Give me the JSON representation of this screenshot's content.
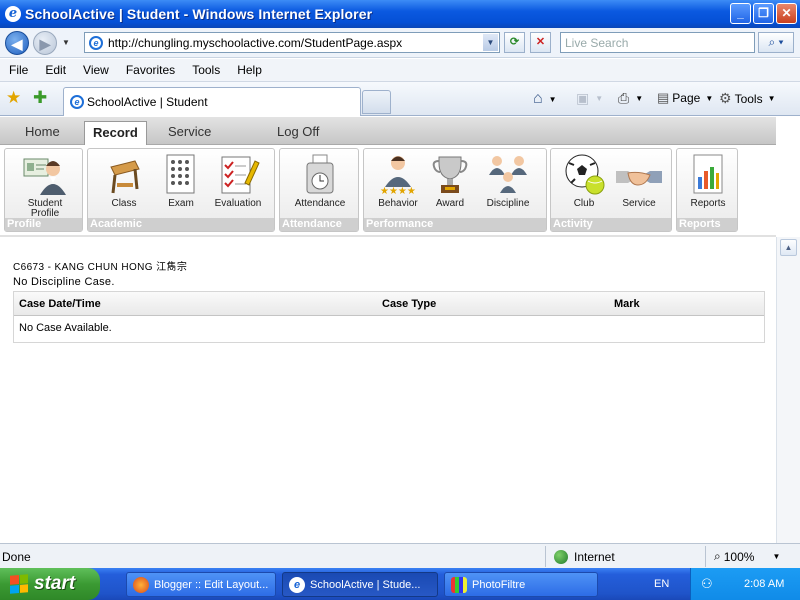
{
  "window": {
    "title": "SchoolActive | Student - Windows Internet Explorer"
  },
  "address": {
    "url": "http://chungling.myschoolactive.com/StudentPage.aspx",
    "search_placeholder": "Live Search"
  },
  "menu": [
    "File",
    "Edit",
    "View",
    "Favorites",
    "Tools",
    "Help"
  ],
  "tab": {
    "title": "SchoolActive | Student"
  },
  "commands": {
    "page": "Page",
    "tools": "Tools"
  },
  "app_nav": [
    "Home",
    "Record",
    "Service",
    "Log Off"
  ],
  "app_nav_active": "Record",
  "groups": [
    {
      "label": "Profile",
      "items": [
        {
          "label": "Student Profile",
          "icon": "student-profile-icon"
        }
      ]
    },
    {
      "label": "Academic",
      "items": [
        {
          "label": "Class",
          "icon": "class-desk-icon"
        },
        {
          "label": "Exam",
          "icon": "exam-sheet-icon"
        },
        {
          "label": "Evaluation",
          "icon": "evaluation-checklist-icon"
        }
      ]
    },
    {
      "label": "Attendance",
      "items": [
        {
          "label": "Attendance",
          "icon": "attendance-clock-icon"
        }
      ]
    },
    {
      "label": "Performance",
      "items": [
        {
          "label": "Behavior",
          "icon": "behavior-stars-icon"
        },
        {
          "label": "Award",
          "icon": "award-trophy-icon"
        },
        {
          "label": "Discipline",
          "icon": "discipline-people-icon"
        }
      ]
    },
    {
      "label": "Activity",
      "items": [
        {
          "label": "Club",
          "icon": "club-balls-icon"
        },
        {
          "label": "Service",
          "icon": "service-handshake-icon"
        }
      ]
    },
    {
      "label": "Reports",
      "items": [
        {
          "label": "Reports",
          "icon": "reports-chart-icon"
        }
      ]
    }
  ],
  "student": {
    "heading": "C6673 - KANG CHUN HONG 江雋宗"
  },
  "message": "No Discipline Case.",
  "table": {
    "headers": [
      "Case Date/Time",
      "Case Type",
      "Mark"
    ],
    "empty": "No Case Available."
  },
  "status": {
    "text": "Done",
    "zone": "Internet",
    "zoom": "100%"
  },
  "taskbar": {
    "start": "start",
    "tasks": [
      "Blogger :: Edit Layout...",
      "SchoolActive | Stude...",
      "PhotoFiltre"
    ],
    "lang": "EN",
    "clock": "2:08 AM"
  }
}
